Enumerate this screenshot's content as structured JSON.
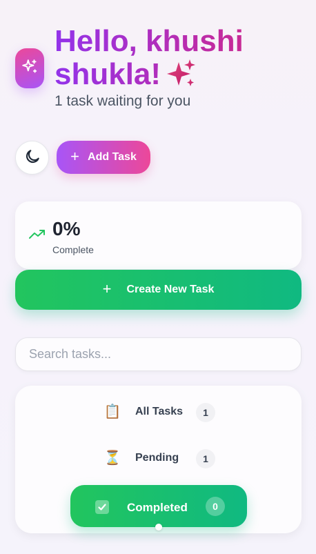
{
  "header": {
    "greeting_line1": "Hello, khushi",
    "greeting_line2": "shukla!",
    "subtitle": "1 task waiting for you",
    "logo_icon": "sparkles-icon",
    "greeting_emoji": "sparkles-icon"
  },
  "toolbar": {
    "theme_icon": "moon-icon",
    "add_task_label": "Add Task"
  },
  "stats": {
    "percent": "0%",
    "label": "Complete",
    "trend_icon": "trending-up-icon",
    "progress": 0
  },
  "create_button_label": "Create New Task",
  "search": {
    "placeholder": "Search tasks...",
    "value": ""
  },
  "filters": [
    {
      "label": "All Tasks",
      "count": "1",
      "emoji": "📋",
      "active": false
    },
    {
      "label": "Pending",
      "count": "1",
      "emoji": "⏳",
      "active": false
    },
    {
      "label": "Completed",
      "count": "0",
      "emoji": "✅",
      "active": true
    }
  ],
  "colors": {
    "brand_purple": "#a855f7",
    "brand_pink": "#ec4899",
    "accent_green": "#22c55e",
    "accent_teal": "#10b981"
  }
}
